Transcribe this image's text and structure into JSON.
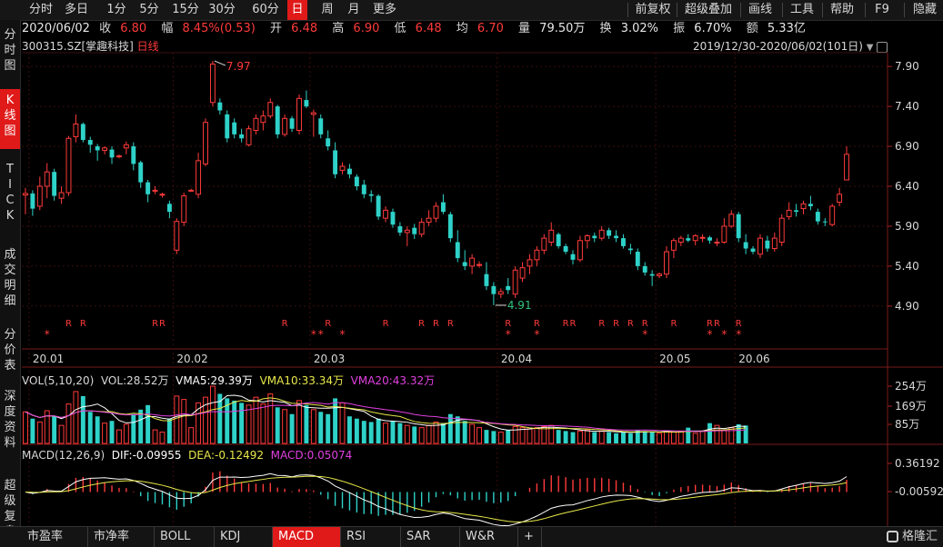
{
  "toolbar": {
    "periods": [
      "分时",
      "多日",
      "1分",
      "5分",
      "15分",
      "30分",
      "60分",
      "日",
      "周",
      "月",
      "更多"
    ],
    "active_period": "日",
    "right_tools": [
      "前复权",
      "超级叠加",
      "画线",
      "工具",
      "帮助",
      "F9",
      "隐藏"
    ]
  },
  "info": {
    "date": "2020/06/02",
    "close_label": "收",
    "close": "6.80",
    "change_label": "幅",
    "change": "8.45%(0.53)",
    "open_label": "开",
    "open": "6.48",
    "high_label": "高",
    "high": "6.90",
    "low_label": "低",
    "low": "6.48",
    "avg_label": "均",
    "avg": "6.70",
    "volume_label": "量",
    "volume": "79.50万",
    "turnover_label": "换",
    "turnover": "3.02%",
    "amplitude_label": "振",
    "amplitude": "6.70%",
    "amount_label": "额",
    "amount": "5.33亿"
  },
  "stock": {
    "code": "300315.SZ",
    "name": "[掌趣科技]",
    "period_tag": "日线"
  },
  "range": {
    "text": "2019/12/30-2020/06/02(101日)"
  },
  "left_tabs": [
    "分时图",
    "K线图",
    "TICK",
    "成交明细",
    "分价表",
    "深度资料",
    "超级复盘"
  ],
  "active_left_tab": "K线图",
  "price_axis": {
    "ticks": [
      "7.90",
      "7.40",
      "6.90",
      "6.40",
      "5.90",
      "5.40",
      "4.90"
    ]
  },
  "date_axis": {
    "ticks": [
      "20.01",
      "20.02",
      "20.03",
      "20.04",
      "20.05",
      "20.06"
    ]
  },
  "annotations": {
    "max": "7.97",
    "min": "4.91",
    "r_mark": "R",
    "star_mark": "*"
  },
  "volume_panel": {
    "title": "VOL(5,10,20)",
    "vol": "VOL:28.52万",
    "vma5": "VMA5:29.39万",
    "vma10": "VMA10:33.34万",
    "vma20": "VMA20:43.32万",
    "ticks": [
      "254万",
      "169万",
      "85万"
    ]
  },
  "macd_panel": {
    "title": "MACD(12,26,9)",
    "dif": "DIF:-0.09955",
    "dea": "DEA:-0.12492",
    "macd": "MACD:0.05074",
    "ticks": [
      "0.36192",
      "-0.00592"
    ]
  },
  "bottom_tabs": [
    "市盈率",
    "市净率",
    "BOLL",
    "KDJ",
    "MACD",
    "RSI",
    "SAR",
    "W&R",
    "+"
  ],
  "active_bottom_tab": "MACD",
  "logo": "格隆汇",
  "colors": {
    "up": "#ff3a3a",
    "down": "#2ed2c8",
    "vma5": "#ffffff",
    "vma10": "#e8e84a",
    "vma20": "#e040e0",
    "accent": "#e01919"
  },
  "chart_data": {
    "type": "candlestick",
    "candles": [
      {
        "o": 6.29,
        "h": 6.38,
        "l": 6.05,
        "c": 6.31
      },
      {
        "o": 6.31,
        "h": 6.35,
        "l": 6.03,
        "c": 6.12
      },
      {
        "o": 6.15,
        "h": 6.52,
        "l": 6.1,
        "c": 6.4
      },
      {
        "o": 6.4,
        "h": 6.69,
        "l": 6.25,
        "c": 6.58
      },
      {
        "o": 6.58,
        "h": 6.62,
        "l": 6.22,
        "c": 6.28
      },
      {
        "o": 6.25,
        "h": 6.4,
        "l": 6.18,
        "c": 6.32
      },
      {
        "o": 6.32,
        "h": 7.03,
        "l": 6.28,
        "c": 7.0
      },
      {
        "o": 7.02,
        "h": 7.3,
        "l": 6.95,
        "c": 7.18
      },
      {
        "o": 7.18,
        "h": 7.2,
        "l": 6.95,
        "c": 6.98
      },
      {
        "o": 6.98,
        "h": 7.02,
        "l": 6.82,
        "c": 6.92
      },
      {
        "o": 6.9,
        "h": 6.93,
        "l": 6.72,
        "c": 6.85
      },
      {
        "o": 6.85,
        "h": 6.9,
        "l": 6.8,
        "c": 6.88
      },
      {
        "o": 6.86,
        "h": 6.9,
        "l": 6.68,
        "c": 6.76
      },
      {
        "o": 6.78,
        "h": 6.8,
        "l": 6.75,
        "c": 6.78
      },
      {
        "o": 6.88,
        "h": 6.96,
        "l": 6.8,
        "c": 6.92
      },
      {
        "o": 6.9,
        "h": 6.95,
        "l": 6.6,
        "c": 6.68
      },
      {
        "o": 6.7,
        "h": 6.72,
        "l": 6.38,
        "c": 6.45
      },
      {
        "o": 6.45,
        "h": 6.48,
        "l": 6.2,
        "c": 6.3
      },
      {
        "o": 6.34,
        "h": 6.4,
        "l": 6.3,
        "c": 6.35
      },
      {
        "o": 6.3,
        "h": 6.32,
        "l": 6.26,
        "c": 6.3
      },
      {
        "o": 6.18,
        "h": 6.22,
        "l": 6.0,
        "c": 6.08
      },
      {
        "o": 5.6,
        "h": 6.0,
        "l": 5.55,
        "c": 5.96
      },
      {
        "o": 5.95,
        "h": 6.32,
        "l": 5.9,
        "c": 6.28
      },
      {
        "o": 6.35,
        "h": 6.37,
        "l": 6.33,
        "c": 6.35
      },
      {
        "o": 6.3,
        "h": 6.82,
        "l": 6.25,
        "c": 6.72
      },
      {
        "o": 6.68,
        "h": 7.25,
        "l": 6.65,
        "c": 7.2
      },
      {
        "o": 7.45,
        "h": 7.97,
        "l": 7.4,
        "c": 7.93
      },
      {
        "o": 7.45,
        "h": 7.5,
        "l": 7.3,
        "c": 7.35
      },
      {
        "o": 7.3,
        "h": 7.35,
        "l": 6.95,
        "c": 7.0
      },
      {
        "o": 7.2,
        "h": 7.25,
        "l": 7.0,
        "c": 7.05
      },
      {
        "o": 7.05,
        "h": 7.12,
        "l": 6.95,
        "c": 7.0
      },
      {
        "o": 6.92,
        "h": 7.16,
        "l": 6.9,
        "c": 7.12
      },
      {
        "o": 7.1,
        "h": 7.3,
        "l": 7.05,
        "c": 7.25
      },
      {
        "o": 7.2,
        "h": 7.35,
        "l": 7.1,
        "c": 7.28
      },
      {
        "o": 7.28,
        "h": 7.5,
        "l": 7.25,
        "c": 7.45
      },
      {
        "o": 7.4,
        "h": 7.42,
        "l": 7.0,
        "c": 7.05
      },
      {
        "o": 7.05,
        "h": 7.3,
        "l": 7.02,
        "c": 7.25
      },
      {
        "o": 7.25,
        "h": 7.28,
        "l": 7.08,
        "c": 7.12
      },
      {
        "o": 7.1,
        "h": 7.55,
        "l": 7.05,
        "c": 7.5
      },
      {
        "o": 7.48,
        "h": 7.6,
        "l": 7.38,
        "c": 7.4
      },
      {
        "o": 7.3,
        "h": 7.36,
        "l": 7.02,
        "c": 7.32
      },
      {
        "o": 7.25,
        "h": 7.3,
        "l": 7.0,
        "c": 7.05
      },
      {
        "o": 7.0,
        "h": 7.1,
        "l": 6.85,
        "c": 6.9
      },
      {
        "o": 6.85,
        "h": 6.95,
        "l": 6.5,
        "c": 6.55
      },
      {
        "o": 6.6,
        "h": 6.7,
        "l": 6.55,
        "c": 6.65
      },
      {
        "o": 6.62,
        "h": 6.68,
        "l": 6.5,
        "c": 6.55
      },
      {
        "o": 6.52,
        "h": 6.55,
        "l": 6.35,
        "c": 6.4
      },
      {
        "o": 6.42,
        "h": 6.48,
        "l": 6.25,
        "c": 6.3
      },
      {
        "o": 6.3,
        "h": 6.35,
        "l": 6.2,
        "c": 6.28
      },
      {
        "o": 6.28,
        "h": 6.3,
        "l": 5.98,
        "c": 6.02
      },
      {
        "o": 6.0,
        "h": 6.15,
        "l": 5.95,
        "c": 6.1
      },
      {
        "o": 6.08,
        "h": 6.12,
        "l": 5.88,
        "c": 5.92
      },
      {
        "o": 5.9,
        "h": 5.95,
        "l": 5.78,
        "c": 5.82
      },
      {
        "o": 5.82,
        "h": 5.9,
        "l": 5.65,
        "c": 5.85
      },
      {
        "o": 5.88,
        "h": 5.93,
        "l": 5.74,
        "c": 5.8
      },
      {
        "o": 5.8,
        "h": 6.0,
        "l": 5.76,
        "c": 5.95
      },
      {
        "o": 5.95,
        "h": 6.1,
        "l": 5.9,
        "c": 6.0
      },
      {
        "o": 6.0,
        "h": 6.2,
        "l": 5.95,
        "c": 6.15
      },
      {
        "o": 6.2,
        "h": 6.3,
        "l": 6.05,
        "c": 6.08
      },
      {
        "o": 6.05,
        "h": 6.08,
        "l": 5.7,
        "c": 5.75
      },
      {
        "o": 5.7,
        "h": 5.85,
        "l": 5.45,
        "c": 5.5
      },
      {
        "o": 5.45,
        "h": 5.6,
        "l": 5.35,
        "c": 5.4
      },
      {
        "o": 5.4,
        "h": 5.55,
        "l": 5.3,
        "c": 5.5
      },
      {
        "o": 5.42,
        "h": 5.46,
        "l": 5.38,
        "c": 5.42
      },
      {
        "o": 5.3,
        "h": 5.45,
        "l": 5.1,
        "c": 5.15
      },
      {
        "o": 5.15,
        "h": 5.2,
        "l": 4.91,
        "c": 5.05
      },
      {
        "o": 5.05,
        "h": 5.12,
        "l": 5.0,
        "c": 5.08
      },
      {
        "o": 5.15,
        "h": 5.25,
        "l": 5.05,
        "c": 5.1
      },
      {
        "o": 5.05,
        "h": 5.4,
        "l": 5.0,
        "c": 5.35
      },
      {
        "o": 5.25,
        "h": 5.45,
        "l": 5.2,
        "c": 5.38
      },
      {
        "o": 5.4,
        "h": 5.55,
        "l": 5.3,
        "c": 5.48
      },
      {
        "o": 5.48,
        "h": 5.65,
        "l": 5.4,
        "c": 5.6
      },
      {
        "o": 5.6,
        "h": 5.8,
        "l": 5.55,
        "c": 5.75
      },
      {
        "o": 5.7,
        "h": 5.95,
        "l": 5.65,
        "c": 5.85
      },
      {
        "o": 5.8,
        "h": 5.82,
        "l": 5.62,
        "c": 5.65
      },
      {
        "o": 5.65,
        "h": 5.68,
        "l": 5.55,
        "c": 5.58
      },
      {
        "o": 5.55,
        "h": 5.6,
        "l": 5.42,
        "c": 5.48
      },
      {
        "o": 5.48,
        "h": 5.78,
        "l": 5.45,
        "c": 5.72
      },
      {
        "o": 5.72,
        "h": 5.8,
        "l": 5.62,
        "c": 5.78
      },
      {
        "o": 5.78,
        "h": 5.82,
        "l": 5.7,
        "c": 5.75
      },
      {
        "o": 5.75,
        "h": 5.9,
        "l": 5.72,
        "c": 5.85
      },
      {
        "o": 5.85,
        "h": 5.88,
        "l": 5.74,
        "c": 5.78
      },
      {
        "o": 5.78,
        "h": 5.85,
        "l": 5.7,
        "c": 5.75
      },
      {
        "o": 5.75,
        "h": 5.8,
        "l": 5.62,
        "c": 5.65
      },
      {
        "o": 5.62,
        "h": 5.68,
        "l": 5.55,
        "c": 5.6
      },
      {
        "o": 5.58,
        "h": 5.62,
        "l": 5.35,
        "c": 5.4
      },
      {
        "o": 5.4,
        "h": 5.45,
        "l": 5.28,
        "c": 5.32
      },
      {
        "o": 5.3,
        "h": 5.35,
        "l": 5.15,
        "c": 5.28
      },
      {
        "o": 5.28,
        "h": 5.32,
        "l": 5.25,
        "c": 5.3
      },
      {
        "o": 5.3,
        "h": 5.65,
        "l": 5.25,
        "c": 5.58
      },
      {
        "o": 5.6,
        "h": 5.75,
        "l": 5.5,
        "c": 5.72
      },
      {
        "o": 5.7,
        "h": 5.78,
        "l": 5.65,
        "c": 5.75
      },
      {
        "o": 5.75,
        "h": 5.8,
        "l": 5.7,
        "c": 5.72
      },
      {
        "o": 5.72,
        "h": 5.8,
        "l": 5.66,
        "c": 5.78
      },
      {
        "o": 5.76,
        "h": 5.8,
        "l": 5.7,
        "c": 5.76
      },
      {
        "o": 5.76,
        "h": 5.78,
        "l": 5.68,
        "c": 5.72
      },
      {
        "o": 5.7,
        "h": 5.75,
        "l": 5.65,
        "c": 5.7
      },
      {
        "o": 5.7,
        "h": 6.0,
        "l": 5.68,
        "c": 5.9
      },
      {
        "o": 5.9,
        "h": 6.1,
        "l": 5.88,
        "c": 6.05
      },
      {
        "o": 6.05,
        "h": 6.08,
        "l": 5.7,
        "c": 5.75
      },
      {
        "o": 5.7,
        "h": 5.8,
        "l": 5.55,
        "c": 5.62
      },
      {
        "o": 5.62,
        "h": 5.65,
        "l": 5.55,
        "c": 5.58
      },
      {
        "o": 5.55,
        "h": 5.8,
        "l": 5.5,
        "c": 5.75
      },
      {
        "o": 5.72,
        "h": 5.78,
        "l": 5.58,
        "c": 5.62
      },
      {
        "o": 5.62,
        "h": 5.82,
        "l": 5.58,
        "c": 5.75
      },
      {
        "o": 5.7,
        "h": 6.05,
        "l": 5.65,
        "c": 6.0
      },
      {
        "o": 6.02,
        "h": 6.2,
        "l": 5.98,
        "c": 6.1
      },
      {
        "o": 6.1,
        "h": 6.18,
        "l": 6.02,
        "c": 6.08
      },
      {
        "o": 6.12,
        "h": 6.22,
        "l": 6.05,
        "c": 6.18
      },
      {
        "o": 6.18,
        "h": 6.28,
        "l": 6.1,
        "c": 6.15
      },
      {
        "o": 6.08,
        "h": 6.12,
        "l": 5.92,
        "c": 5.96
      },
      {
        "o": 5.96,
        "h": 6.0,
        "l": 5.9,
        "c": 5.95
      },
      {
        "o": 5.92,
        "h": 6.18,
        "l": 5.9,
        "c": 6.15
      },
      {
        "o": 6.2,
        "h": 6.38,
        "l": 6.15,
        "c": 6.3
      },
      {
        "o": 6.48,
        "h": 6.9,
        "l": 6.48,
        "c": 6.8
      }
    ],
    "volumes": [
      140,
      110,
      95,
      145,
      120,
      80,
      175,
      230,
      210,
      140,
      120,
      90,
      100,
      60,
      85,
      130,
      150,
      170,
      60,
      50,
      110,
      210,
      195,
      70,
      180,
      205,
      254,
      220,
      200,
      190,
      180,
      170,
      205,
      175,
      220,
      160,
      150,
      130,
      190,
      170,
      150,
      140,
      130,
      200,
      180,
      120,
      110,
      100,
      95,
      110,
      90,
      100,
      90,
      80,
      75,
      70,
      80,
      95,
      90,
      130,
      120,
      100,
      85,
      70,
      60,
      55,
      50,
      60,
      75,
      70,
      65,
      70,
      75,
      80,
      60,
      55,
      50,
      55,
      60,
      50,
      55,
      50,
      45,
      50,
      45,
      60,
      55,
      50,
      45,
      55,
      50,
      55,
      70,
      45,
      55,
      90,
      80,
      60,
      70,
      85,
      79.5
    ],
    "ylim": [
      4.75,
      8.05
    ],
    "vol_max": 254,
    "macd_range": [
      -0.38,
      0.38
    ]
  }
}
